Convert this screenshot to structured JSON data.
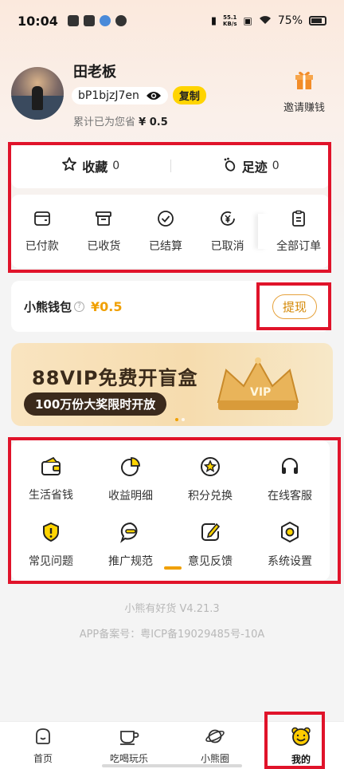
{
  "status_bar": {
    "time": "10:04",
    "net_speed_value": "55.1",
    "net_speed_unit": "KB/s",
    "battery": "75%"
  },
  "profile": {
    "name": "田老板",
    "invite_code": "bP1bjzJ7en",
    "copy_label": "复制",
    "saved_prefix": "累计已为您省",
    "saved_amount": "¥ 0.5",
    "invite_label": "邀请赚钱"
  },
  "favorites": {
    "label": "收藏",
    "count": "0"
  },
  "footprints": {
    "label": "足迹",
    "count": "0"
  },
  "orders": [
    {
      "label": "已付款",
      "icon": "wallet-icon"
    },
    {
      "label": "已收货",
      "icon": "box-icon"
    },
    {
      "label": "已结算",
      "icon": "check-circle-icon"
    },
    {
      "label": "已取消",
      "icon": "yen-cancel-icon"
    },
    {
      "label": "全部订单",
      "icon": "clipboard-icon"
    }
  ],
  "wallet": {
    "title": "小熊钱包",
    "amount": "¥0.5",
    "withdraw_label": "提现"
  },
  "banner": {
    "title": "88VIP免费开盲盒",
    "subtitle": "100万份大奖限时开放",
    "crown_text": "VIP"
  },
  "tools": [
    {
      "label": "生活省钱",
      "icon": "wallet-card-icon"
    },
    {
      "label": "收益明细",
      "icon": "pie-chart-icon"
    },
    {
      "label": "积分兑换",
      "icon": "star-coin-icon"
    },
    {
      "label": "在线客服",
      "icon": "headset-icon"
    },
    {
      "label": "常见问题",
      "icon": "shield-exclamation-icon"
    },
    {
      "label": "推广规范",
      "icon": "message-icon"
    },
    {
      "label": "意见反馈",
      "icon": "edit-icon"
    },
    {
      "label": "系统设置",
      "icon": "settings-icon"
    }
  ],
  "footer": {
    "version": "小熊有好货 V4.21.3",
    "icp": "APP备案号：粤ICP备19029485号-10A"
  },
  "tabbar": [
    {
      "label": "首页",
      "icon": "home-icon",
      "active": false
    },
    {
      "label": "吃喝玩乐",
      "icon": "coffee-cup-icon",
      "active": false
    },
    {
      "label": "小熊圈",
      "icon": "planet-icon",
      "active": false
    },
    {
      "label": "我的",
      "icon": "bear-face-icon",
      "active": true
    }
  ],
  "colors": {
    "highlight_frame": "#e0132a",
    "accent_yellow": "#ffd400",
    "accent_orange": "#f0a000"
  }
}
